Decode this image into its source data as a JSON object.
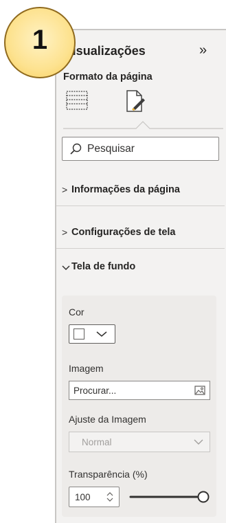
{
  "panel": {
    "title": "Visualizações",
    "collapse_icon": "double-chevron-right-icon",
    "subtitle": "Formato da página"
  },
  "search": {
    "placeholder": "Pesquisar"
  },
  "sections": [
    {
      "label": "Informações da página",
      "expanded": false
    },
    {
      "label": "Configurações de tela",
      "expanded": false
    },
    {
      "label": "Tela de fundo",
      "expanded": true
    }
  ],
  "background": {
    "color_label": "Cor",
    "color_value": "#ffffff",
    "image_label": "Imagem",
    "image_button": "Procurar...",
    "fit_label": "Ajuste da Imagem",
    "fit_value": "Normal",
    "transparency_label": "Transparência (%)",
    "transparency_value": "100"
  },
  "badge": {
    "number": "1"
  },
  "colors": {
    "accent_badge": "#fde28f",
    "panel_bg": "#f3f2f1",
    "card_bg": "#edebe9"
  }
}
